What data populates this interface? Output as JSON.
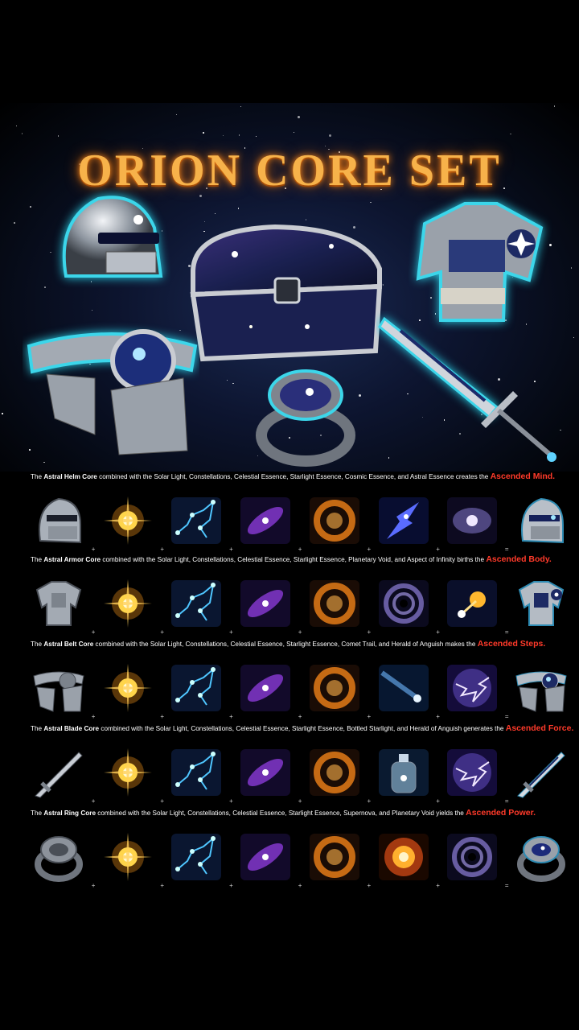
{
  "title": "ORION CORE SET",
  "recipes": [
    {
      "prefix": "The ",
      "core": "Astral Helm Core",
      "middle": " combined with the Solar Light, Constellations, Celestial Essence, Starlight Essence, Cosmic Essence, and Astral Essence creates the ",
      "result": "Ascended Mind.",
      "ingredients": [
        "helm-icon",
        "solar-light-icon",
        "constellations-icon",
        "celestial-essence-icon",
        "starlight-essence-icon",
        "cosmic-essence-icon",
        "astral-essence-icon",
        "ascended-helm-icon"
      ]
    },
    {
      "prefix": "The ",
      "core": "Astral Armor Core",
      "middle": " combined with the Solar Light, Constellations, Celestial Essence, Starlight Essence, Planetary Void, and Aspect of Infinity births the ",
      "result": "Ascended Body.",
      "ingredients": [
        "armor-icon",
        "solar-light-icon",
        "constellations-icon",
        "celestial-essence-icon",
        "starlight-essence-icon",
        "planetary-void-icon",
        "aspect-of-infinity-icon",
        "ascended-armor-icon"
      ]
    },
    {
      "prefix": "The ",
      "core": "Astral Belt Core",
      "middle": " combined with the Solar Light, Constellations, Celestial Essence, Starlight Essence, Comet Trail, and Herald of Anguish makes the ",
      "result": "Ascended Steps.",
      "ingredients": [
        "belt-icon",
        "solar-light-icon",
        "constellations-icon",
        "celestial-essence-icon",
        "starlight-essence-icon",
        "comet-trail-icon",
        "herald-of-anguish-icon",
        "ascended-belt-icon"
      ]
    },
    {
      "prefix": "The ",
      "core": "Astral Blade Core",
      "middle": " combined with the Solar Light, Constellations, Celestial Essence, Starlight Essence, Bottled Starlight, and Herald of Anguish generates the ",
      "result": "Ascended Force.",
      "ingredients": [
        "blade-icon",
        "solar-light-icon",
        "constellations-icon",
        "celestial-essence-icon",
        "starlight-essence-icon",
        "bottled-starlight-icon",
        "herald-of-anguish-icon",
        "ascended-blade-icon"
      ]
    },
    {
      "prefix": "The ",
      "core": "Astral Ring Core",
      "middle": " combined with the Solar Light, Constellations, Celestial Essence, Starlight Essence, Supernova, and Planetary Void yields the ",
      "result": "Ascended Power.",
      "ingredients": [
        "ring-icon",
        "solar-light-icon",
        "constellations-icon",
        "celestial-essence-icon",
        "starlight-essence-icon",
        "supernova-icon",
        "planetary-void-icon",
        "ascended-ring-icon"
      ]
    }
  ],
  "symbols": {
    "plus": "+",
    "equals": "="
  },
  "colors": {
    "title": "#f7b24a",
    "result": "#ff3a2a",
    "glow": "#39d2e8"
  }
}
